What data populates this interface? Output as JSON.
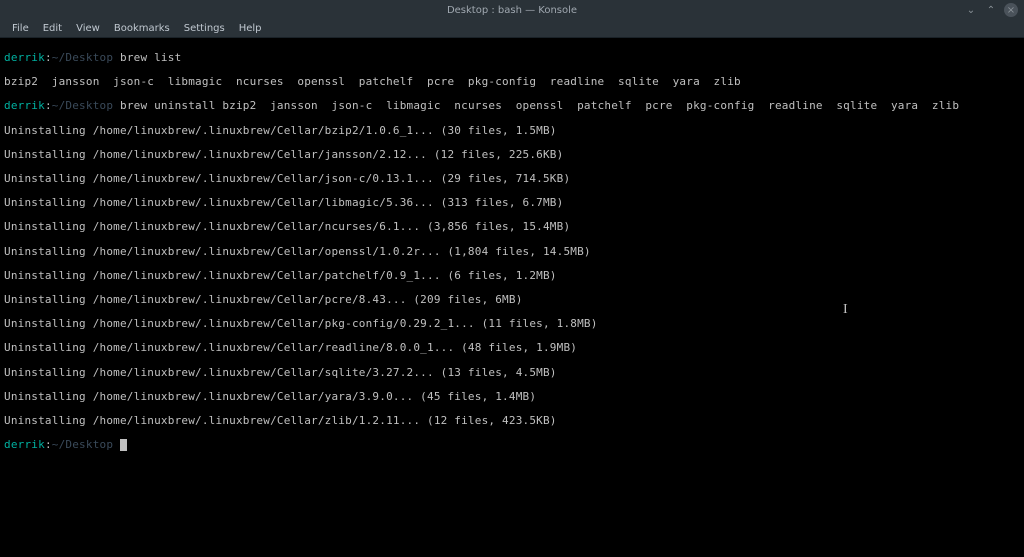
{
  "window": {
    "title": "Desktop : bash — Konsole"
  },
  "menubar": {
    "items": [
      "File",
      "Edit",
      "View",
      "Bookmarks",
      "Settings",
      "Help"
    ]
  },
  "prompt": {
    "user": "derrik",
    "sep": ":",
    "path": "~/Desktop"
  },
  "commands": {
    "cmd1": " brew list",
    "cmd2": " brew uninstall bzip2  jansson  json-c  libmagic  ncurses  openssl  patchelf  pcre  pkg-config  readline  sqlite  yara  zlib"
  },
  "output": {
    "list": "bzip2  jansson  json-c  libmagic  ncurses  openssl  patchelf  pcre  pkg-config  readline  sqlite  yara  zlib",
    "lines": [
      "Uninstalling /home/linuxbrew/.linuxbrew/Cellar/bzip2/1.0.6_1... (30 files, 1.5MB)",
      "Uninstalling /home/linuxbrew/.linuxbrew/Cellar/jansson/2.12... (12 files, 225.6KB)",
      "Uninstalling /home/linuxbrew/.linuxbrew/Cellar/json-c/0.13.1... (29 files, 714.5KB)",
      "Uninstalling /home/linuxbrew/.linuxbrew/Cellar/libmagic/5.36... (313 files, 6.7MB)",
      "Uninstalling /home/linuxbrew/.linuxbrew/Cellar/ncurses/6.1... (3,856 files, 15.4MB)",
      "Uninstalling /home/linuxbrew/.linuxbrew/Cellar/openssl/1.0.2r... (1,804 files, 14.5MB)",
      "Uninstalling /home/linuxbrew/.linuxbrew/Cellar/patchelf/0.9_1... (6 files, 1.2MB)",
      "Uninstalling /home/linuxbrew/.linuxbrew/Cellar/pcre/8.43... (209 files, 6MB)",
      "Uninstalling /home/linuxbrew/.linuxbrew/Cellar/pkg-config/0.29.2_1... (11 files, 1.8MB)",
      "Uninstalling /home/linuxbrew/.linuxbrew/Cellar/readline/8.0.0_1... (48 files, 1.9MB)",
      "Uninstalling /home/linuxbrew/.linuxbrew/Cellar/sqlite/3.27.2... (13 files, 4.5MB)",
      "Uninstalling /home/linuxbrew/.linuxbrew/Cellar/yara/3.9.0... (45 files, 1.4MB)",
      "Uninstalling /home/linuxbrew/.linuxbrew/Cellar/zlib/1.2.11... (12 files, 423.5KB)"
    ]
  }
}
